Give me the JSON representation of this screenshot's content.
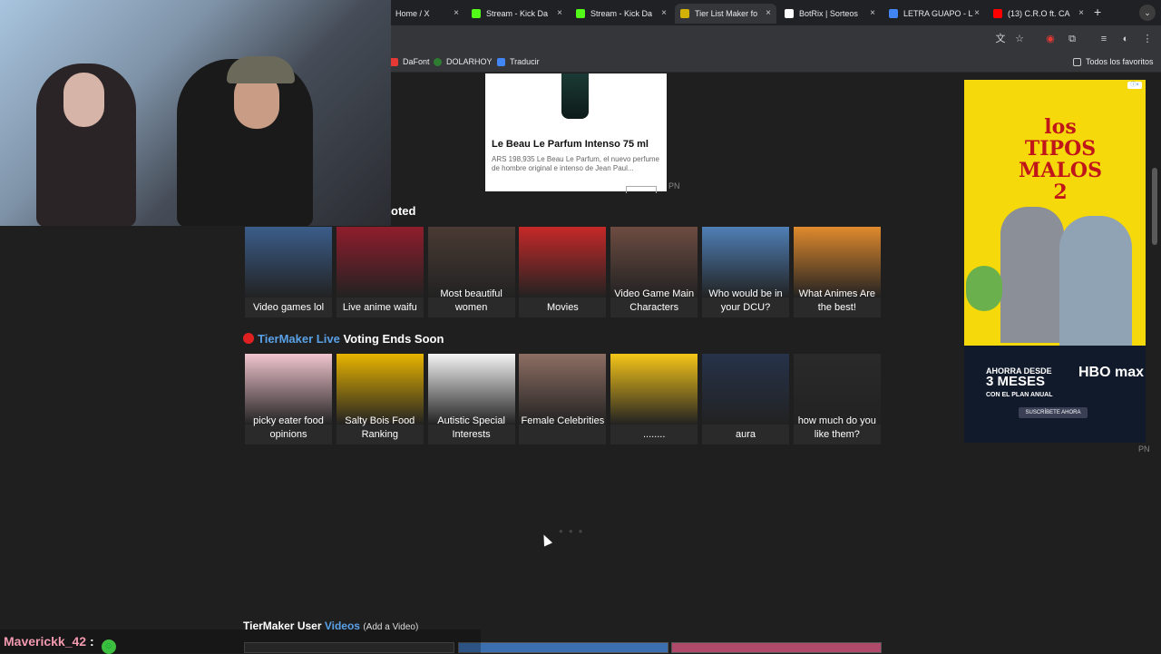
{
  "browser": {
    "tabs": [
      {
        "title": "Home / X",
        "favicon_color": "#000000",
        "active": false
      },
      {
        "title": "Stream - Kick Da",
        "favicon_color": "#53fc18",
        "active": false
      },
      {
        "title": "Stream - Kick Da",
        "favicon_color": "#53fc18",
        "active": false
      },
      {
        "title": "Tier List Maker fo",
        "favicon_color": "#d4b106",
        "active": true
      },
      {
        "title": "BotRix | Sorteos",
        "favicon_color": "#ffffff",
        "active": false
      },
      {
        "title": "LETRA GUAPO - L",
        "favicon_color": "#4285f4",
        "active": false
      },
      {
        "title": "(13) C.R.O ft. CA",
        "favicon_color": "#ff0000",
        "active": false
      }
    ],
    "new_tab": "+",
    "tab_menu": "⌄",
    "bookmarks": [
      {
        "label": "DaFont",
        "color": "#e53935"
      },
      {
        "label": "DOLARHOY",
        "color": "#2e7d32"
      },
      {
        "label": "Traducir",
        "color": "#4285f4"
      }
    ],
    "all_bookmarks": "Todos los favoritos"
  },
  "ad_card": {
    "title": "Le Beau Le Parfum Intenso 75 ml",
    "description": "ARS 198,935 Le Beau Le Parfum, el nuevo perfume de hombre original e intenso de Jean Paul..."
  },
  "pn_label": "PN",
  "section_featured": {
    "title_fragment": "oted",
    "cards": [
      {
        "label": "Video games lol",
        "color": "#3b5d8a"
      },
      {
        "label": "Live anime waifu",
        "color": "#8f1d2c"
      },
      {
        "label": "Most beautiful women",
        "color": "#4a3a33"
      },
      {
        "label": "Movies",
        "color": "#c62828"
      },
      {
        "label": "Video Game Main Characters",
        "color": "#6d4c41"
      },
      {
        "label": "Who would be in your DCU?",
        "color": "#4f7fb6"
      },
      {
        "label": "What Animes Are the best!",
        "color": "#e08a2d"
      }
    ]
  },
  "section_live": {
    "brand": "TierMaker Live",
    "suffix": "Voting Ends Soon",
    "cards": [
      {
        "label": "picky eater food opinions",
        "color": "#f1c5cf"
      },
      {
        "label": "Salty Bois Food Ranking",
        "color": "#e8b400"
      },
      {
        "label": "Autistic Special Interests",
        "color": "#f4f4f4"
      },
      {
        "label": "Female Celebrities",
        "color": "#8d6e63"
      },
      {
        "label": "........",
        "color": "#f5c518"
      },
      {
        "label": "aura",
        "color": "#26324a"
      },
      {
        "label": "how much do you like them?",
        "color": "#2a2a2a"
      }
    ]
  },
  "big_ad": {
    "title": "los TIPOS MALOS 2",
    "offer_line1": "AHORRA DESDE",
    "offer_months": "3 MESES",
    "offer_line3": "CON EL PLAN ANUAL",
    "brand": "HBO max",
    "cta": "SUSCRÍBETE AHORA"
  },
  "videos_section": {
    "title_prefix": "TierMaker User",
    "title_blue": "Videos",
    "add_link": "(Add a Video)"
  },
  "chat": {
    "username": "Maverickk_42",
    "separator": ":"
  }
}
